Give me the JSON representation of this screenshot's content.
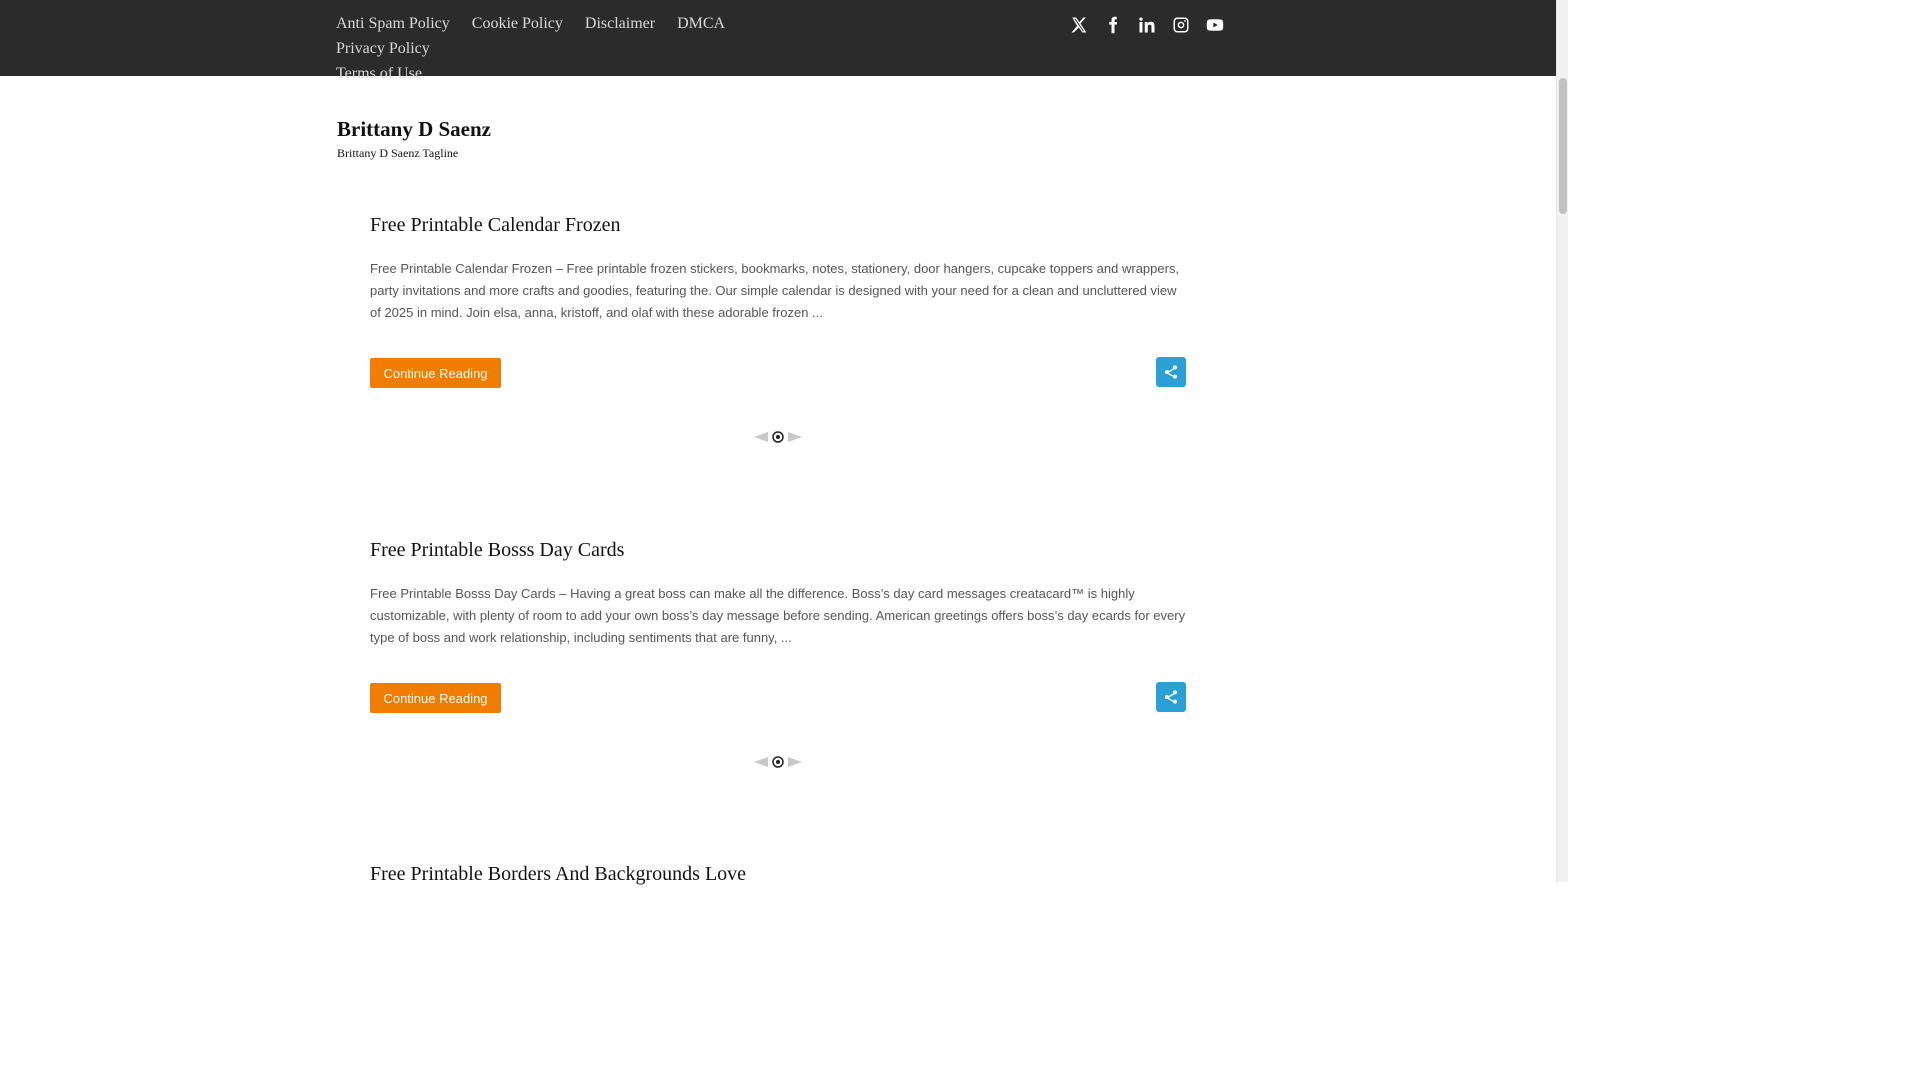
{
  "topnav": {
    "items": [
      "Anti Spam Policy",
      "Cookie Policy",
      "Disclaimer",
      "DMCA",
      "Privacy Policy",
      "Terms of Use"
    ]
  },
  "social": {
    "icons": [
      "x-twitter-icon",
      "facebook-icon",
      "linkedin-icon",
      "instagram-icon",
      "youtube-icon"
    ]
  },
  "site": {
    "title": "Brittany D Saenz",
    "tagline": "Brittany D Saenz Tagline"
  },
  "posts": [
    {
      "title": "Free Printable Calendar Frozen",
      "excerpt": "Free Printable Calendar Frozen – Free printable frozen stickers, bookmarks, notes, stationery, door hangers, cupcake toppers and wrappers, party invitations and more crafts and goodies, featuring the. Our simple calendar is designed with your need for a clean and uncluttered view of 2025 in mind. Join elsa, anna, kristoff, and olaf with these adorable frozen ...",
      "button": "Continue Reading"
    },
    {
      "title": "Free Printable Bosss Day Cards",
      "excerpt": "Free Printable Bosss Day Cards – Having a great boss can make all the difference. Boss’s day card messages creatacard™ is highly customizable, with plenty of room to add your own boss’s day message before sending. American greetings offers boss’s day ecards for every type of boss and work relationship, including sentiments that are funny, ...",
      "button": "Continue Reading"
    },
    {
      "title": "Free Printable Borders And Backgrounds Love"
    }
  ],
  "colors": {
    "topbar": "#2b2b2b",
    "button": "#f07c00",
    "share": "#2aa0d6"
  }
}
